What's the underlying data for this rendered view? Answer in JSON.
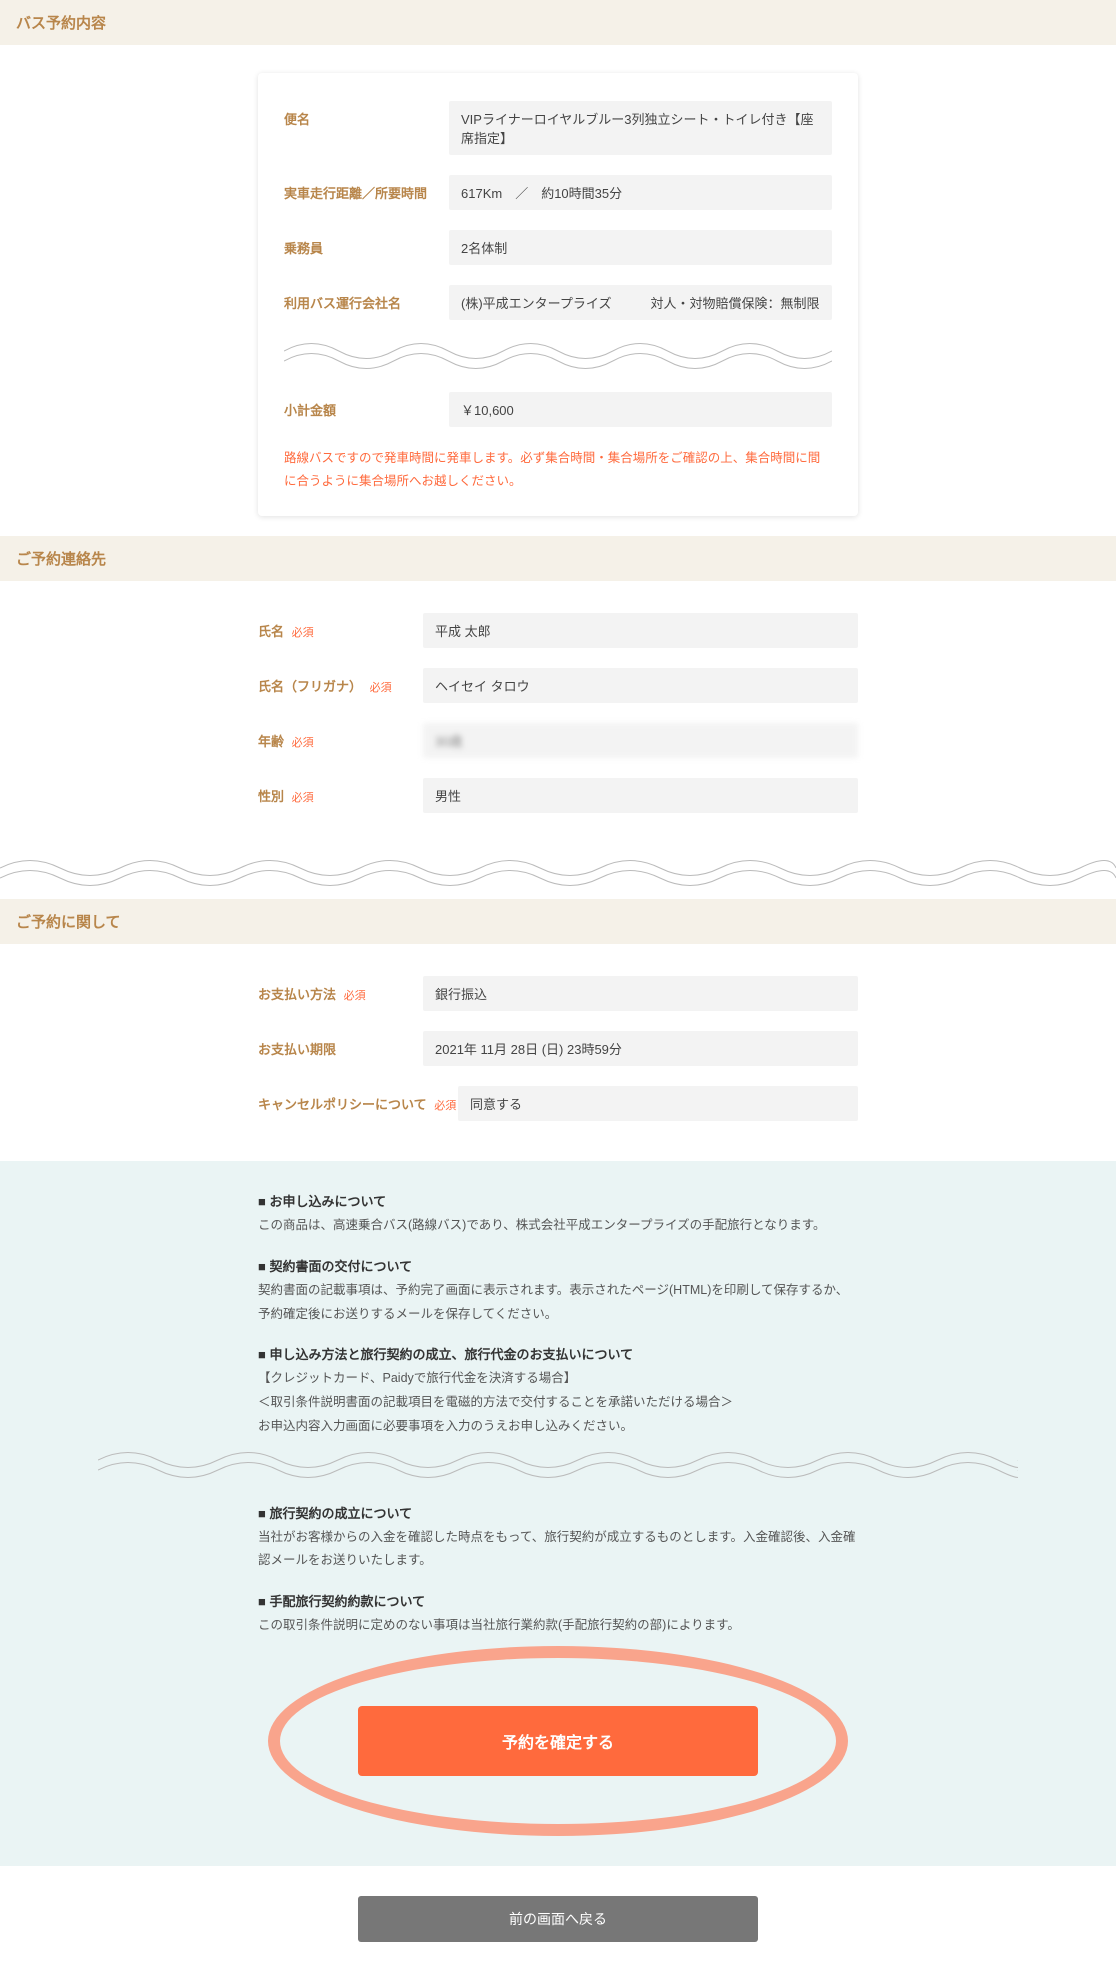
{
  "sections": {
    "bus": {
      "title": "バス予約内容",
      "rows": {
        "name_label": "便名",
        "name_value": "VIPライナーロイヤルブルー3列独立シート・トイレ付き【座席指定】",
        "dist_label": "実車走行距離／所要時間",
        "dist_value": "617Km　／　約10時間35分",
        "crew_label": "乗務員",
        "crew_value": "2名体制",
        "company_label": "利用バス運行会社名",
        "company_value": "(株)平成エンタープライズ　　　対人・対物賠償保険：無制限",
        "subtotal_label": "小計金額",
        "subtotal_value": "￥10,600"
      },
      "note": "路線バスですので発車時間に発車します。必ず集合時間・集合場所をご確認の上、集合時間に間に合うように集合場所へお越しください。"
    },
    "contact": {
      "title": "ご予約連絡先",
      "rows": {
        "name_label": "氏名",
        "name_value": "平成 太郎",
        "kana_label": "氏名（フリガナ）",
        "kana_value": "ヘイセイ タロウ",
        "age_label": "年齢",
        "age_value": "30歳",
        "gender_label": "性別",
        "gender_value": "男性"
      }
    },
    "reservation": {
      "title": "ご予約に関して",
      "rows": {
        "pay_label": "お支払い方法",
        "pay_value": "銀行振込",
        "deadline_label": "お支払い期限",
        "deadline_value": "2021年 11月 28日 (日) 23時59分",
        "cancel_label": "キャンセルポリシーについて",
        "cancel_value": "同意する"
      }
    }
  },
  "required_tag": "必須",
  "info": {
    "h1": "■ お申し込みについて",
    "p1": "この商品は、高速乗合バス(路線バス)であり、株式会社平成エンタープライズの手配旅行となります。",
    "h2": "■ 契約書面の交付について",
    "p2": "契約書面の記載事項は、予約完了画面に表示されます。表示されたページ(HTML)を印刷して保存するか、予約確定後にお送りするメールを保存してください。",
    "h3": "■ 申し込み方法と旅行契約の成立、旅行代金のお支払いについて",
    "p3a": "【クレジットカード、Paidyで旅行代金を決済する場合】",
    "p3b": "＜取引条件説明書面の記載項目を電磁的方法で交付することを承諾いただける場合＞",
    "p3c": "お申込内容入力画面に必要事項を入力のうえお申し込みください。",
    "h4": "■ 旅行契約の成立について",
    "p4": "当社がお客様からの入金を確認した時点をもって、旅行契約が成立するものとします。入金確認後、入金確認メールをお送りいたします。",
    "h5": "■ 手配旅行契約約款について",
    "p5": "この取引条件説明に定めのない事項は当社旅行業約款(手配旅行契約の部)によります。"
  },
  "buttons": {
    "confirm": "予約を確定する",
    "back": "前の画面へ戻る"
  }
}
